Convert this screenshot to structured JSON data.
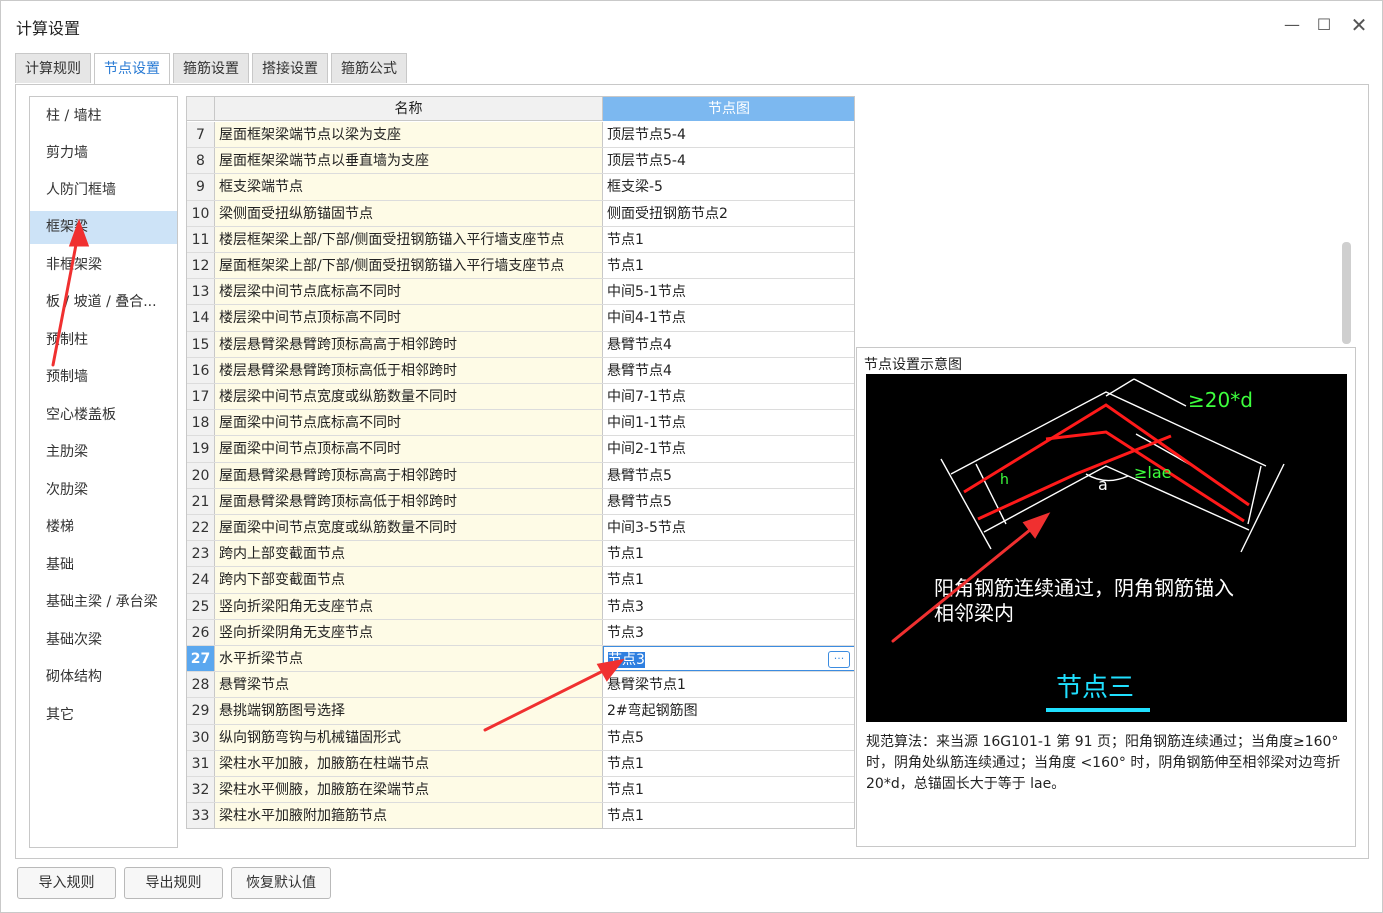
{
  "window": {
    "title": "计算设置",
    "minimize_icon": "minimize-icon",
    "maximize_icon": "maximize-icon",
    "close_icon": "close-icon"
  },
  "tabs": [
    {
      "label": "计算规则",
      "active": false
    },
    {
      "label": "节点设置",
      "active": true
    },
    {
      "label": "箍筋设置",
      "active": false
    },
    {
      "label": "搭接设置",
      "active": false
    },
    {
      "label": "箍筋公式",
      "active": false
    }
  ],
  "sidebar": {
    "selected_index": 3,
    "items": [
      "柱 / 墙柱",
      "剪力墙",
      "人防门框墙",
      "框架梁",
      "非框架梁",
      "板 / 坡道 / 叠合...",
      "预制柱",
      "预制墙",
      "空心楼盖板",
      "主肋梁",
      "次肋梁",
      "楼梯",
      "基础",
      "基础主梁 / 承台梁",
      "基础次梁",
      "砌体结构",
      "其它"
    ]
  },
  "grid": {
    "headers": {
      "name": "名称",
      "node": "节点图"
    },
    "selected_row": 27,
    "rows": [
      {
        "num": "7",
        "name": "屋面框架梁端节点以梁为支座",
        "node": "顶层节点5-4"
      },
      {
        "num": "8",
        "name": "屋面框架梁端节点以垂直墙为支座",
        "node": "顶层节点5-4"
      },
      {
        "num": "9",
        "name": "框支梁端节点",
        "node": "框支梁-5"
      },
      {
        "num": "10",
        "name": "梁侧面受扭纵筋锚固节点",
        "node": "侧面受扭钢筋节点2"
      },
      {
        "num": "11",
        "name": "楼层框架梁上部/下部/侧面受扭钢筋锚入平行墙支座节点",
        "node": "节点1"
      },
      {
        "num": "12",
        "name": "屋面框架梁上部/下部/侧面受扭钢筋锚入平行墙支座节点",
        "node": "节点1"
      },
      {
        "num": "13",
        "name": "楼层梁中间节点底标高不同时",
        "node": "中间5-1节点"
      },
      {
        "num": "14",
        "name": "楼层梁中间节点顶标高不同时",
        "node": "中间4-1节点"
      },
      {
        "num": "15",
        "name": "楼层悬臂梁悬臂跨顶标高高于相邻跨时",
        "node": "悬臂节点4"
      },
      {
        "num": "16",
        "name": "楼层悬臂梁悬臂跨顶标高低于相邻跨时",
        "node": "悬臂节点4"
      },
      {
        "num": "17",
        "name": "楼层梁中间节点宽度或纵筋数量不同时",
        "node": "中间7-1节点"
      },
      {
        "num": "18",
        "name": "屋面梁中间节点底标高不同时",
        "node": "中间1-1节点"
      },
      {
        "num": "19",
        "name": "屋面梁中间节点顶标高不同时",
        "node": "中间2-1节点"
      },
      {
        "num": "20",
        "name": "屋面悬臂梁悬臂跨顶标高高于相邻跨时",
        "node": "悬臂节点5"
      },
      {
        "num": "21",
        "name": "屋面悬臂梁悬臂跨顶标高低于相邻跨时",
        "node": "悬臂节点5"
      },
      {
        "num": "22",
        "name": "屋面梁中间节点宽度或纵筋数量不同时",
        "node": "中间3-5节点"
      },
      {
        "num": "23",
        "name": "跨内上部变截面节点",
        "node": "节点1"
      },
      {
        "num": "24",
        "name": "跨内下部变截面节点",
        "node": "节点1"
      },
      {
        "num": "25",
        "name": "竖向折梁阳角无支座节点",
        "node": "节点3"
      },
      {
        "num": "26",
        "name": "竖向折梁阴角无支座节点",
        "node": "节点3"
      },
      {
        "num": "27",
        "name": "水平折梁节点",
        "node": "节点3"
      },
      {
        "num": "28",
        "name": "悬臂梁节点",
        "node": "悬臂梁节点1"
      },
      {
        "num": "29",
        "name": "悬挑端钢筋图号选择",
        "node": "2#弯起钢筋图"
      },
      {
        "num": "30",
        "name": "纵向钢筋弯钩与机械锚固形式",
        "node": "节点5"
      },
      {
        "num": "31",
        "name": "梁柱水平加腋，加腋筋在柱端节点",
        "node": "节点1"
      },
      {
        "num": "32",
        "name": "梁柱水平侧腋，加腋筋在梁端节点",
        "node": "节点1"
      },
      {
        "num": "33",
        "name": "梁柱水平加腋附加箍筋节点",
        "node": "节点1"
      }
    ],
    "ellipsis_label": "···"
  },
  "preview": {
    "title": "节点设置示意图",
    "drawing": {
      "dim_label": "≥20*d",
      "lae_label": "≥lae",
      "angle_label": "a",
      "h_label": "h",
      "caption_line1": "阳角钢筋连续通过，阴角钢筋锚入",
      "caption_line2": "相邻梁内",
      "node_title": "节点三",
      "line_color": "#ff1a1a",
      "outline_color": "#ffffff",
      "dim_color": "#3dff3d",
      "title_color": "#20e0ff"
    },
    "rule_text": "规范算法：来当源 16G101-1 第 91 页；阳角钢筋连续通过；当角度≥160° 时，阴角处纵筋连续通过；当角度 <160° 时，阴角钢筋伸至相邻梁对边弯折 20*d，总锚固长大于等于 lae。"
  },
  "buttons": {
    "import": "导入规则",
    "export": "导出规则",
    "restore": "恢复默认值"
  },
  "annotation_color": "#f03030"
}
